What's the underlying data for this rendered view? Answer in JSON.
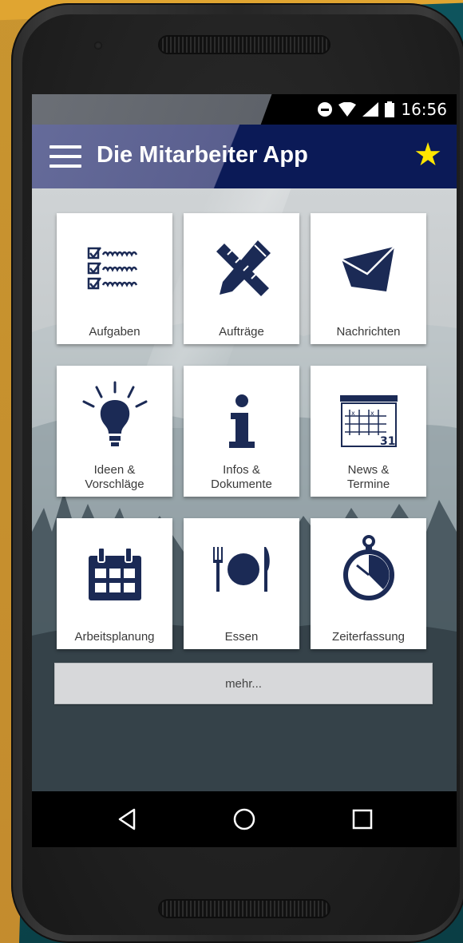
{
  "status_bar": {
    "time": "16:56"
  },
  "app_bar": {
    "title": "Die Mitarbeiter App"
  },
  "tiles": [
    {
      "label": "Aufgaben"
    },
    {
      "label": "Aufträge"
    },
    {
      "label": "Nachrichten"
    },
    {
      "label_line1": "Ideen &",
      "label_line2": "Vorschläge"
    },
    {
      "label_line1": "Infos &",
      "label_line2": "Dokumente"
    },
    {
      "label_line1": "News &",
      "label_line2": "Termine"
    },
    {
      "label": "Arbeitsplanung"
    },
    {
      "label": "Essen"
    },
    {
      "label": "Zeiterfassung"
    }
  ],
  "more_button": {
    "label": "mehr..."
  },
  "calendar_icon_day": "31",
  "colors": {
    "icon_navy": "#1b2a55",
    "appbar_dark": "#0b1a57",
    "appbar_light": "#656b9a",
    "star": "#ffe600",
    "background_teal": "#0f5a63",
    "accent_orange": "#e0a531"
  }
}
